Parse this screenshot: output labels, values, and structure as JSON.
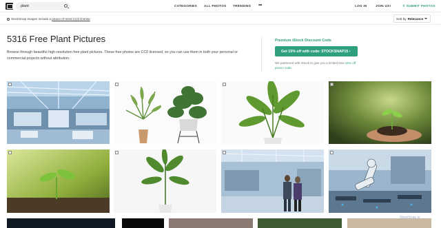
{
  "header": {
    "search_value": "plant",
    "nav": [
      "CATEGORIES",
      "ALL PHOTOS",
      "TRENDING"
    ],
    "more_label": "•••",
    "login": "LOG IN",
    "join": "JOIN US!",
    "submit": "SUBMIT PHOTOS"
  },
  "subbar": {
    "license_prefix": "StockSnap images include a ",
    "license_link": "peace-of-mind CC0 license",
    "sort_prefix": "Sort by",
    "sort_value": "Relevance"
  },
  "main": {
    "title": "5316 Free Plant Pictures",
    "description": "Browse through beautiful high-resolution free plant pictures. These free photos are CC0 licensed, so you can use them in both your personal or commercial projects without attribution."
  },
  "promo": {
    "title": "Premium iStock Discount Code",
    "button": "Get 15% off with code: STOCKSNAP15 ›",
    "note_prefix": "We partnered with iStock to give you a limited time ",
    "note_link": "15% off promo code."
  },
  "photos": [
    {
      "icon": "factory-photo"
    },
    {
      "icon": "potted-palm-monstera-photo"
    },
    {
      "icon": "potted-banana-plant-photo"
    },
    {
      "icon": "seedling-in-hands-photo"
    },
    {
      "icon": "sprout-in-soil-photo"
    },
    {
      "icon": "potted-plant-white-photo"
    },
    {
      "icon": "engineers-in-factory-photo"
    },
    {
      "icon": "robot-arm-photo"
    }
  ],
  "watermark": "StockSnap.io",
  "colors": {
    "accent": "#2ea07d"
  }
}
